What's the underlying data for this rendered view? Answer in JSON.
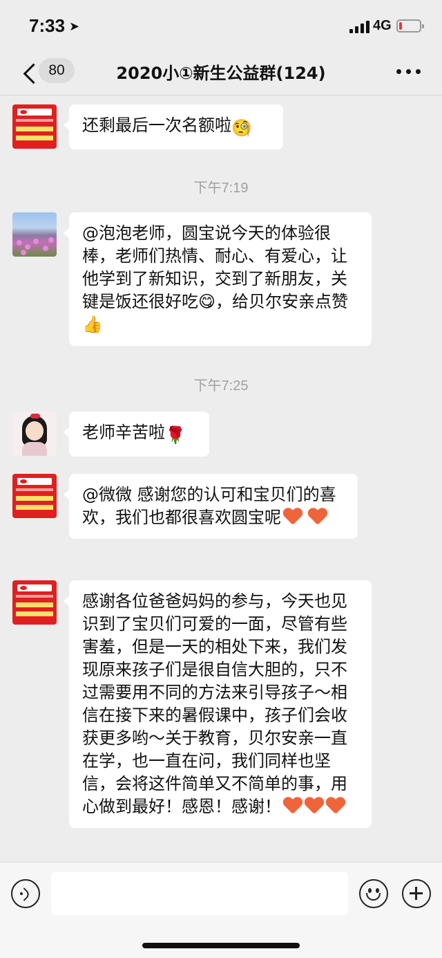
{
  "status_bar": {
    "time": "7:33",
    "location_icon": "location-arrow-icon",
    "network": "4G",
    "battery_level": 0.15
  },
  "nav": {
    "unread_count": "80",
    "title": "2020小①新生公益群(124)",
    "back_icon": "chevron-left-icon",
    "more_icon": "more-dots-icon"
  },
  "messages": [
    {
      "type": "text",
      "avatar": "org-logo",
      "text": "还剩最后一次名额啦",
      "emoji": "🧐"
    },
    {
      "type": "time",
      "text": "下午7:19"
    },
    {
      "type": "text",
      "avatar": "flower-photo",
      "text": "@泡泡老师，圆宝说今天的体验很棒，老师们热情、耐心、有爱心，让他学到了新知识，交到了新朋友，关键是饭还很好吃😋，给贝尔安亲点赞👍"
    },
    {
      "type": "time",
      "text": "下午7:25"
    },
    {
      "type": "text",
      "avatar": "cartoon-girl",
      "text": "老师辛苦啦",
      "emoji": "🌹"
    },
    {
      "type": "text",
      "avatar": "org-logo",
      "text": "@微微 感谢您的认可和宝贝们的喜欢，我们也都很喜欢圆宝呢",
      "hearts": 2
    },
    {
      "type": "text",
      "avatar": "org-logo",
      "text": "感谢各位爸爸妈妈的参与，今天也见识到了宝贝们可爱的一面，尽管有些害羞，但是一天的相处下来，我们发现原来孩子们是很自信大胆的，只不过需要用不同的方法来引导孩子～相信在接下来的暑假课中，孩子们会收获更多哟～关于教育，贝尔安亲一直在学，也一直在问，我们同样也坚信，会将这件简单又不简单的事，用心做到最好！感恩！感谢！",
      "hearts": 3
    }
  ],
  "input_bar": {
    "voice_icon": "voice-icon",
    "emoji_icon": "emoji-face-icon",
    "plus_icon": "plus-circle-icon",
    "heart_color": "#f0643a"
  }
}
